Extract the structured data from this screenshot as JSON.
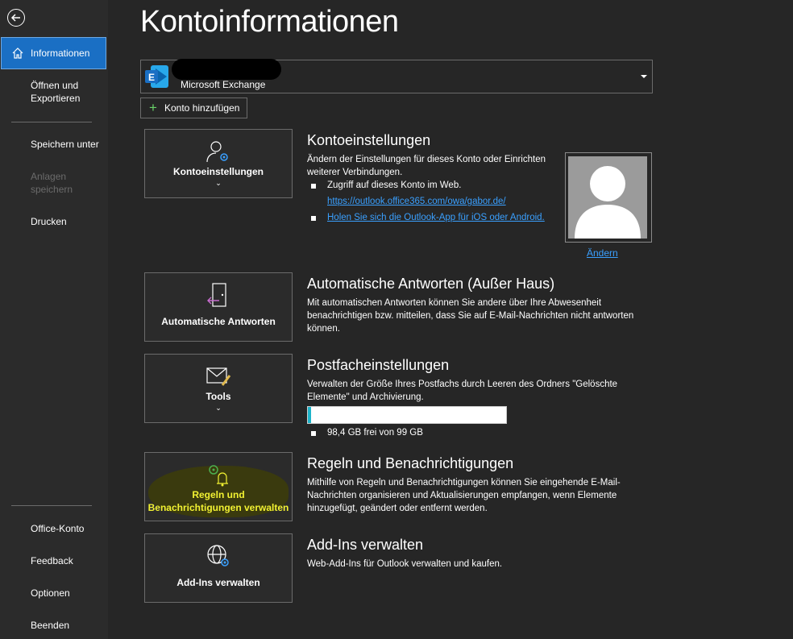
{
  "sidebar": {
    "items": [
      {
        "label": "Informationen"
      },
      {
        "label": "Öffnen und Exportieren"
      },
      {
        "label": "Speichern unter"
      },
      {
        "label": "Anlagen speichern"
      },
      {
        "label": "Drucken"
      },
      {
        "label": "Office-Konto"
      },
      {
        "label": "Feedback"
      },
      {
        "label": "Optionen"
      },
      {
        "label": "Beenden"
      }
    ]
  },
  "page": {
    "title": "Kontoinformationen"
  },
  "account": {
    "type": "Microsoft Exchange",
    "add_label": "Konto hinzufügen"
  },
  "sections": {
    "account_settings": {
      "tile_label": "Kontoeinstellungen",
      "title": "Kontoeinstellungen",
      "desc": "Ändern der Einstellungen für dieses Konto oder Einrichten weiterer Verbindungen.",
      "bullet1": "Zugriff auf dieses Konto im Web.",
      "link1": "https://outlook.office365.com/owa/gabor.de/",
      "link2": "Holen Sie sich die Outlook-App für iOS oder Android.",
      "avatar_change": "Ändern"
    },
    "auto_reply": {
      "tile_label": "Automatische Antworten",
      "title": "Automatische Antworten (Außer Haus)",
      "desc": "Mit automatischen Antworten können Sie andere über Ihre Abwesenheit benachrichtigen bzw. mitteilen, dass Sie auf E-Mail-Nachrichten nicht antworten können."
    },
    "mailbox": {
      "tile_label": "Tools",
      "title": "Postfacheinstellungen",
      "desc": "Verwalten der Größe Ihres Postfachs durch Leeren des Ordners \"Gelöschte Elemente\" und Archivierung.",
      "free_text": "98,4 GB frei von 99 GB",
      "used_fraction": 0.006
    },
    "rules": {
      "tile_label_line1": "Regeln und",
      "tile_label_line2": "Benachrichtigungen verwalten",
      "title": "Regeln und Benachrichtigungen",
      "desc": "Mithilfe von Regeln und Benachrichtigungen können Sie eingehende E-Mail-Nachrichten organisieren und Aktualisierungen empfangen, wenn Elemente hinzugefügt, geändert oder entfernt werden."
    },
    "addins": {
      "tile_label": "Add-Ins verwalten",
      "title": "Add-Ins verwalten",
      "desc": "Web-Add-Ins für Outlook verwalten und kaufen."
    }
  },
  "colors": {
    "accent": "#1a6fc4",
    "link": "#3aa0ff",
    "progress": "#1db3c9",
    "highlight": "#f2f232"
  }
}
